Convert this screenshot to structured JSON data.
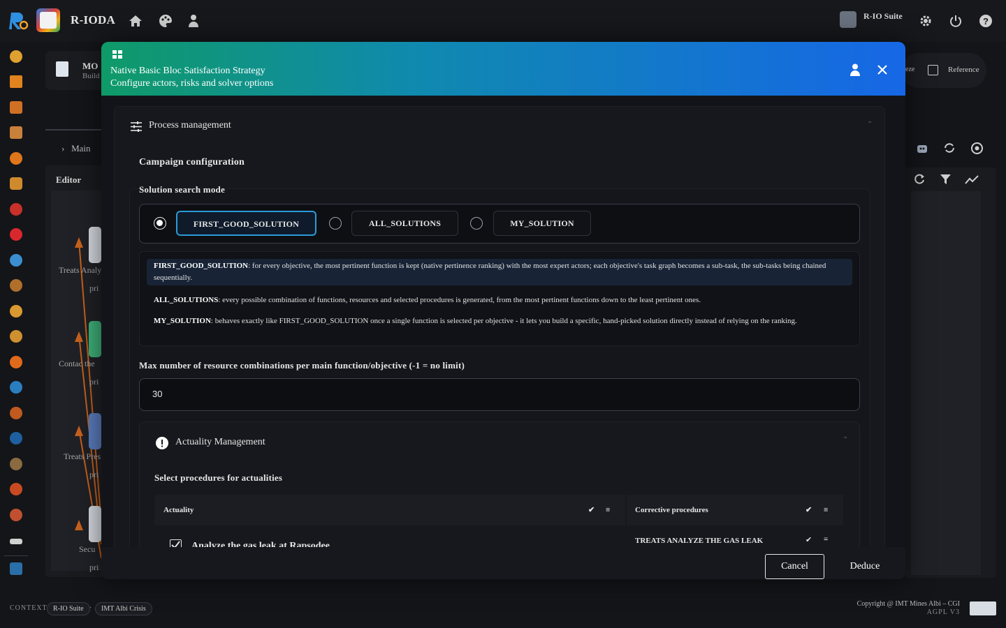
{
  "header": {
    "app_name": "R-IODA",
    "user_label": "R-IO Suite"
  },
  "background": {
    "tab_partial_title": "MO",
    "tab_partial_sub": "Build",
    "breadcrumb": "Main",
    "editor_label": "Editor",
    "toolbar_freeze": "eze",
    "toolbar_reference": "Reference",
    "nodes": [
      {
        "line1": "Treats Analy",
        "line2": "pri"
      },
      {
        "line1": "Contac the",
        "line2": "pri"
      },
      {
        "line1": "Treats Pres",
        "line2": "pri"
      },
      {
        "line1": "Secu",
        "line2": "pri"
      }
    ]
  },
  "modal": {
    "title": "Native Basic Bloc Satisfaction Strategy",
    "subtitle": "Configure actors, risks and solver options",
    "section_title": "Process management",
    "campaign_title": "Campaign configuration",
    "search_mode_label": "Solution search mode",
    "options": [
      {
        "label": "FIRST_GOOD_SOLUTION",
        "selected": true
      },
      {
        "label": "ALL_SOLUTIONS",
        "selected": false
      },
      {
        "label": "MY_SOLUTION",
        "selected": false
      }
    ],
    "descriptions": [
      {
        "key": "FIRST_GOOD_SOLUTION",
        "text": ": for every objective, the most pertinent function is kept (native pertinence ranking) with the most expert actors; each objective's task graph becomes a sub-task, the sub-tasks being chained sequentially."
      },
      {
        "key": "ALL_SOLUTIONS",
        "text": ": every possible combination of functions, resources and selected procedures is generated, from the most pertinent functions down to the least pertinent ones."
      },
      {
        "key": "MY_SOLUTION",
        "text": ": behaves exactly like FIRST_GOOD_SOLUTION once a single function is selected per objective - it lets you build a specific, hand-picked solution directly instead of relying on the ranking."
      }
    ],
    "max_combinations_label": "Max number of resource combinations per main function/objective (-1 = no limit)",
    "max_combinations_value": "30",
    "actuality": {
      "title": "Actuality Management",
      "select_label": "Select procedures for actualities",
      "col_actuality": "Actuality",
      "col_corrective": "Corrective procedures",
      "rows": [
        {
          "actuality": "Analyze the gas leak at Rapsodee",
          "procedure": "TREATS ANALYZE THE GAS LEAK",
          "checked": true
        }
      ]
    },
    "cancel_label": "Cancel",
    "deduce_label": "Deduce"
  },
  "footer": {
    "context_label": "CONTEXT",
    "chip_suite": "R-IO Suite",
    "chip_crisis": "IMT Albi Crisis",
    "copyright": "Copyright @ IMT Mines Albi – CGI",
    "license": "AGPL V3"
  },
  "colors": {
    "header_gradient_start": "#0f9a68",
    "header_gradient_end": "#1667e6",
    "selected_option_border": "#2a9bd8",
    "background": "#141519"
  }
}
